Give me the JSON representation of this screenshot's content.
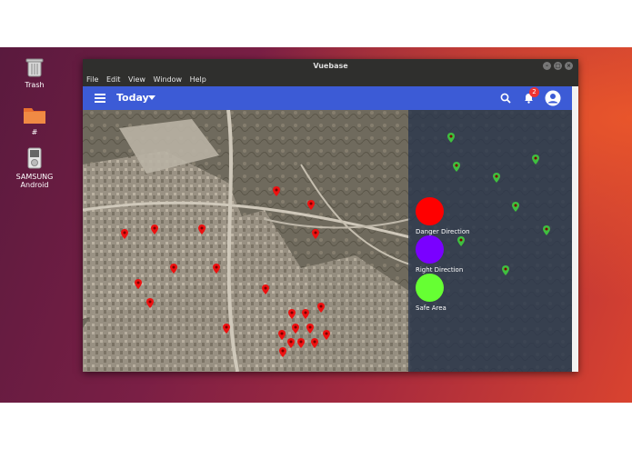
{
  "desktop_icons": {
    "trash": "Trash",
    "folder": "#",
    "device_line1": "SAMSUNG",
    "device_line2": "Android"
  },
  "window": {
    "title": "Vuebase",
    "menu": [
      "File",
      "Edit",
      "View",
      "Window",
      "Help"
    ]
  },
  "toolbar": {
    "title": "Today",
    "notification_count": "2"
  },
  "legend": [
    {
      "label": "Danger Direction",
      "color": "#ff0000"
    },
    {
      "label": "Right Direction",
      "color": "#7a00ff"
    },
    {
      "label": "Safe Area",
      "color": "#66ff33"
    }
  ],
  "colors": {
    "appbar": "#3c5bd6",
    "danger": "#ee1111",
    "safe": "#3fbf3f"
  }
}
